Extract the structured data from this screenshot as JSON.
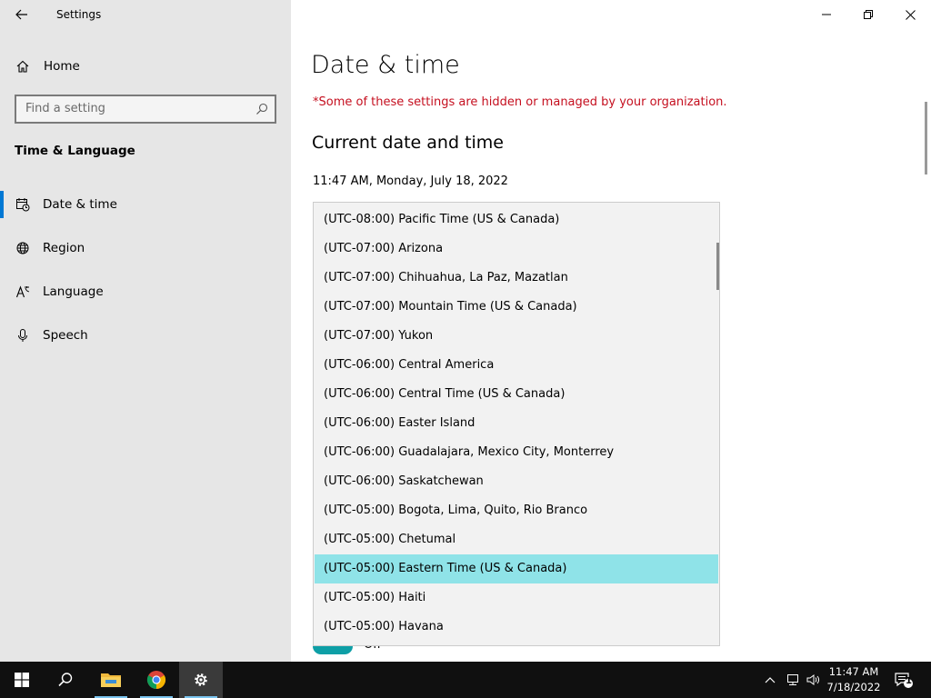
{
  "window": {
    "title": "Settings",
    "controls": {
      "minimize": "minimize",
      "restore": "restore",
      "close": "close"
    }
  },
  "sidebar": {
    "home_label": "Home",
    "search_placeholder": "Find a setting",
    "section_title": "Time & Language",
    "items": [
      {
        "label": "Date & time",
        "icon": "date-time-icon",
        "selected": true
      },
      {
        "label": "Region",
        "icon": "globe-icon",
        "selected": false
      },
      {
        "label": "Language",
        "icon": "language-icon",
        "selected": false
      },
      {
        "label": "Speech",
        "icon": "microphone-icon",
        "selected": false
      }
    ]
  },
  "main": {
    "page_title": "Date & time",
    "org_warning": "*Some of these settings are hidden or managed by your organization.",
    "section_title": "Current date and time",
    "current_datetime": "11:47 AM, Monday, July 18, 2022",
    "toggle_state_label": "Off",
    "timezone_dropdown": {
      "selected": "(UTC-05:00) Eastern Time (US & Canada)",
      "options": [
        "(UTC-08:00) Pacific Time (US & Canada)",
        "(UTC-07:00) Arizona",
        "(UTC-07:00) Chihuahua, La Paz, Mazatlan",
        "(UTC-07:00) Mountain Time (US & Canada)",
        "(UTC-07:00) Yukon",
        "(UTC-06:00) Central America",
        "(UTC-06:00) Central Time (US & Canada)",
        "(UTC-06:00) Easter Island",
        "(UTC-06:00) Guadalajara, Mexico City, Monterrey",
        "(UTC-06:00) Saskatchewan",
        "(UTC-05:00) Bogota, Lima, Quito, Rio Branco",
        "(UTC-05:00) Chetumal",
        "(UTC-05:00) Eastern Time (US & Canada)",
        "(UTC-05:00) Haiti",
        "(UTC-05:00) Havana"
      ]
    }
  },
  "taskbar": {
    "apps": [
      {
        "name": "start",
        "icon": "windows-logo-icon"
      },
      {
        "name": "search",
        "icon": "search-icon"
      },
      {
        "name": "file-explorer",
        "icon": "folder-icon"
      },
      {
        "name": "chrome",
        "icon": "chrome-icon"
      },
      {
        "name": "settings",
        "icon": "gear-icon"
      }
    ],
    "time": "11:47 AM",
    "date": "7/18/2022",
    "notification_count": "1"
  },
  "colors": {
    "accent": "#0078d4",
    "selection": "#8fe3e8",
    "warning": "#c50f1f",
    "toggle_on": "#0e9fa6",
    "sidebar_bg": "#e6e6e6",
    "taskbar_bg": "#101010"
  }
}
